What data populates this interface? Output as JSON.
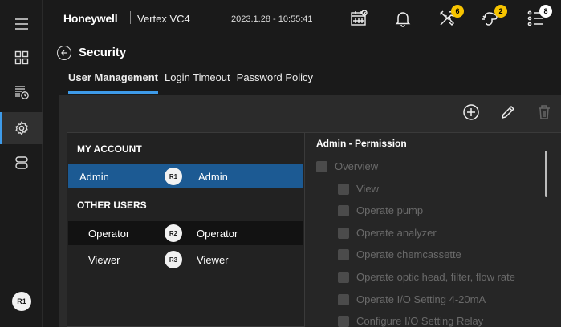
{
  "topbar": {
    "brand": "Honeywell",
    "model": "Vertex VC4",
    "datetime": "2023.1.28 - 10:55:41",
    "badges": {
      "tools": "6",
      "alarms": "2",
      "events": "8"
    }
  },
  "header": {
    "title": "Security",
    "tabs": [
      {
        "label": "User Management"
      },
      {
        "label": "Login Timeout"
      },
      {
        "label": "Password Policy"
      }
    ]
  },
  "sidebar": {
    "avatar": "R1",
    "items": [
      {
        "icon": "menu-icon"
      },
      {
        "icon": "grid-icon"
      },
      {
        "icon": "history-icon"
      },
      {
        "icon": "gear-icon"
      },
      {
        "icon": "storage-icon"
      }
    ]
  },
  "users": {
    "my_account_label": "MY ACCOUNT",
    "other_users_label": "OTHER USERS",
    "my_account": [
      {
        "name": "Admin",
        "badge": "R1",
        "role": "Admin"
      }
    ],
    "other_users": [
      {
        "name": "Operator",
        "badge": "R2",
        "role": "Operator"
      },
      {
        "name": "Viewer",
        "badge": "R3",
        "role": "Viewer"
      }
    ]
  },
  "permissions": {
    "title": "Admin - Permission",
    "items": [
      "Overview",
      "View",
      "Operate pump",
      "Operate analyzer",
      "Operate chemcassette",
      "Operate optic head, filter, flow rate",
      "Operate I/O Setting 4-20mA",
      "Configure I/O Setting Relay"
    ]
  },
  "colors": {
    "accent": "#3e9be9",
    "selected_row": "#1c5a93",
    "badge": "#f7c400"
  }
}
